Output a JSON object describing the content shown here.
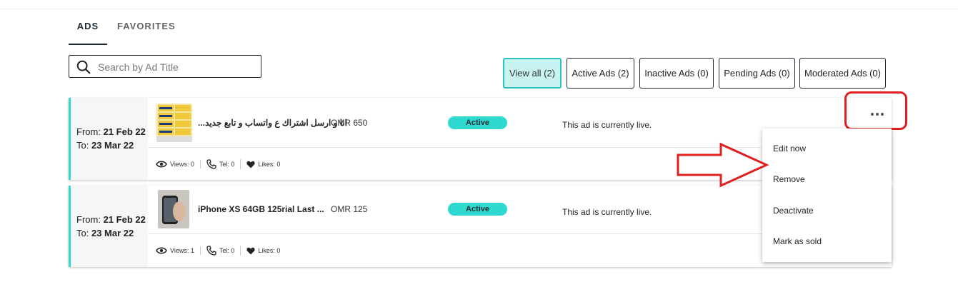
{
  "tabs": [
    {
      "label": "ADS",
      "active": true
    },
    {
      "label": "FAVORITES",
      "active": false
    }
  ],
  "search": {
    "placeholder": "Search by Ad Title",
    "value": ""
  },
  "filters": [
    {
      "label": "View all (2)",
      "active": true
    },
    {
      "label": "Active Ads (2)",
      "active": false
    },
    {
      "label": "Inactive Ads (0)",
      "active": false
    },
    {
      "label": "Pending Ads (0)",
      "active": false
    },
    {
      "label": "Moderated Ads (0)",
      "active": false
    }
  ],
  "ads": [
    {
      "from_label": "From:",
      "from_date": "21 Feb 22",
      "to_label": "To:",
      "to_date": "23 Mar 22",
      "title": "...انا و ارسل اشتراك ع واتساب و تابع جديد",
      "price": "OMR 650",
      "status": "Active",
      "status_text": "This ad is currently live.",
      "views": "Views: 0",
      "tel": "Tel: 0",
      "likes": "Likes: 0"
    },
    {
      "from_label": "From:",
      "from_date": "21 Feb 22",
      "to_label": "To:",
      "to_date": "23 Mar 22",
      "title": "iPhone XS 64GB 125rial Last ...",
      "price": "OMR 125",
      "status": "Active",
      "status_text": "This ad is currently live.",
      "views": "Views: 1",
      "tel": "Tel: 0",
      "likes": "Likes: 0"
    }
  ],
  "menu": {
    "items": [
      "Edit now",
      "Remove",
      "Deactivate",
      "Mark as sold"
    ]
  },
  "colors": {
    "accent": "#2ed9d0",
    "dark": "#1d2b36",
    "annotation_red": "#e02020"
  }
}
